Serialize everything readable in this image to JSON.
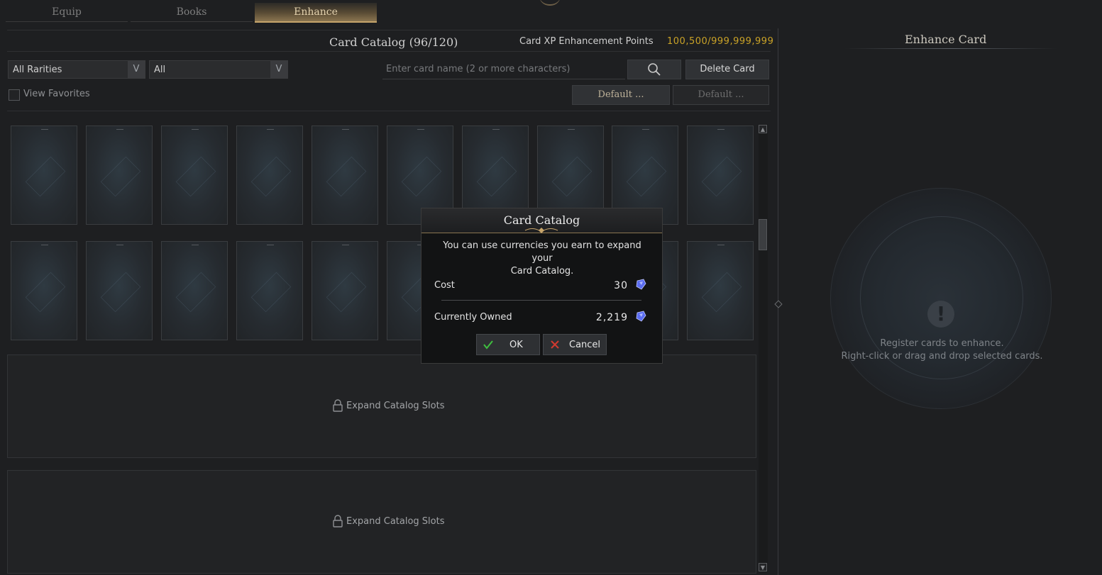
{
  "tabs": [
    {
      "label": "Equip",
      "active": false
    },
    {
      "label": "Books",
      "active": false
    },
    {
      "label": "Enhance",
      "active": true
    }
  ],
  "header": {
    "catalog_title": "Card Catalog (96/120)",
    "xp_label": "Card XP Enhancement Points",
    "xp_value": "100,500/999,999,999"
  },
  "filters": {
    "rarity": "All Rarities",
    "category": "All",
    "search_placeholder": "Enter card name (2 or more characters)",
    "delete_button": "Delete Card",
    "default_button_1": "Default ...",
    "default_button_2": "Default ...",
    "view_favorites": "View Favorites"
  },
  "expand_slots": [
    {
      "label": "Expand Catalog Slots"
    },
    {
      "label": "Expand Catalog Slots"
    }
  ],
  "enhance_panel": {
    "title": "Enhance Card",
    "message_line1": "Register cards to enhance.",
    "message_line2": "Right-click or drag and drop selected cards."
  },
  "dialog": {
    "title": "Card Catalog",
    "message_line1": "You can use currencies you earn to expand your",
    "message_line2": "Card Catalog.",
    "cost_label": "Cost",
    "cost_value": "30",
    "owned_label": "Currently Owned",
    "owned_value": "2,219",
    "ok_label": "OK",
    "cancel_label": "Cancel",
    "currency_icon": "blue-crystal-icon"
  },
  "colors": {
    "accent_gold": "#c9a227",
    "ok_green": "#3fbf3f",
    "cancel_red": "#d23a2f"
  }
}
